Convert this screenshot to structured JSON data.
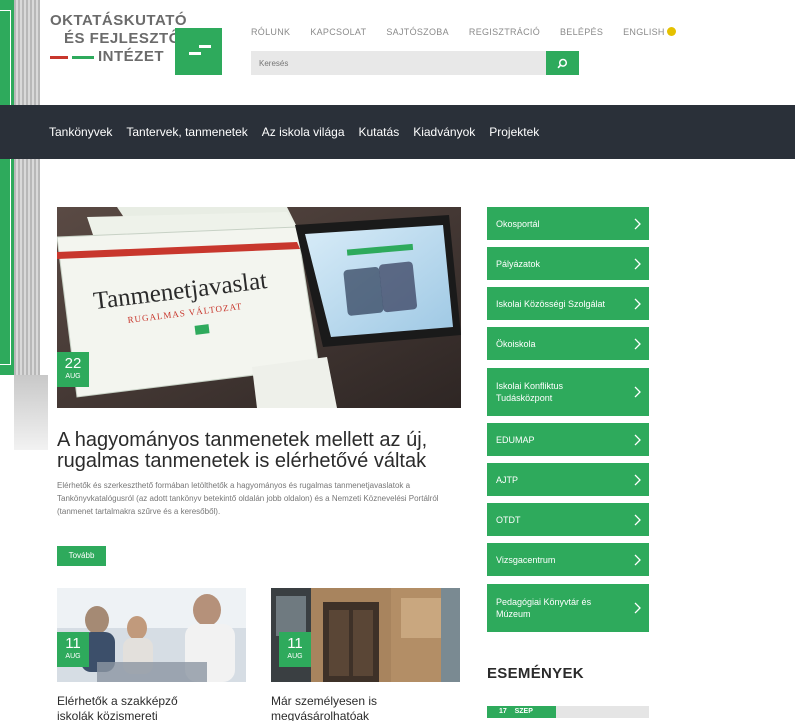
{
  "header": {
    "logo_lines": [
      "OKTATÁSKUTATÓ",
      "ÉS FEJLESZTŐ",
      "INTÉZET"
    ],
    "topnav": [
      "RÓLUNK",
      "KAPCSOLAT",
      "SAJTÓSZOBA",
      "REGISZTRÁCIÓ",
      "BELÉPÉS",
      "ENGLISH"
    ],
    "search_placeholder": "Keresés"
  },
  "mainnav": [
    "Tankönyvek",
    "Tantervek, tanmenetek",
    "Az iskola világa",
    "Kutatás",
    "Kiadványok",
    "Projektek"
  ],
  "featured": {
    "image_text_title": "Tanmenetjavaslat",
    "image_text_subtitle": "RUGALMAS VÁLTOZAT",
    "date_day": "22",
    "date_month": "AUG",
    "headline": "A hagyományos tanmenetek mellett az új, rugalmas tanmenetek is elérhetővé váltak",
    "excerpt": "Elérhetők és szerkeszthető formában letölthetők a hagyományos és rugalmas tanmenetjavaslatok a Tankönyvkatalógusról (az adott tankönyv betekintő oldalán jobb oldalon) és a Nemzeti Köznevelési Portálról (tanmenet tartalmakra szűrve és a keresőből).",
    "more_label": "Tovább"
  },
  "cards": [
    {
      "date_day": "11",
      "date_month": "AUG",
      "title_lines": [
        "Elérhetők a szakképző",
        "iskolák közismereti"
      ]
    },
    {
      "date_day": "11",
      "date_month": "AUG",
      "title_lines": [
        "Már személyesen is",
        "megvásárolhatóak"
      ]
    }
  ],
  "sidebar": {
    "items": [
      "Okosportál",
      "Pályázatok",
      "Iskolai Közösségi Szolgálat",
      "Ökoiskola",
      "Iskolai Konfliktus Tudásközpont",
      "EDUMAP",
      "AJTP",
      "OTDT",
      "Vizsgacentrum",
      "Pedagógiai Könyvtár és Múzeum"
    ],
    "events_title": "ESEMÉNYEK",
    "event_day": "17",
    "event_month": "SZEP"
  },
  "colors": {
    "brand_green": "#2eaa5c",
    "nav_dark": "#2a3039",
    "accent_red": "#c8372d"
  }
}
